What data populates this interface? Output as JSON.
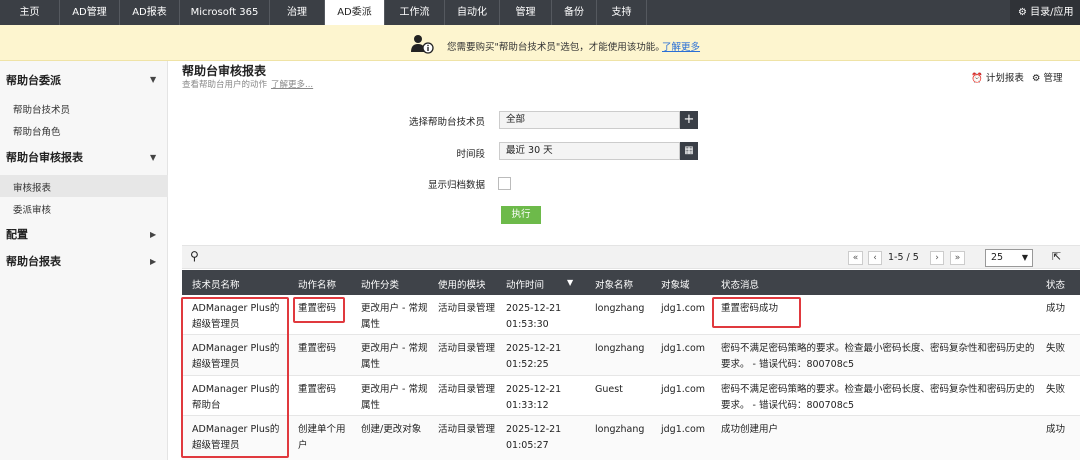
{
  "nav": {
    "tabs": [
      "主页",
      "AD管理",
      "AD报表",
      "Microsoft 365",
      "治理",
      "AD委派",
      "工作流",
      "自动化",
      "管理",
      "备份",
      "支持"
    ],
    "active": "AD委派",
    "tools": "目录/应用"
  },
  "banner": {
    "message": "您需要购买\"帮助台技术员\"选包，才能使用该功能。",
    "link": "了解更多"
  },
  "sidebar": {
    "sections": [
      {
        "title": "帮助台委派",
        "items": [
          "帮助台技术员",
          "帮助台角色"
        ]
      },
      {
        "title": "帮助台审核报表",
        "items": [
          "审核报表",
          "委派审核"
        ]
      },
      {
        "title": "配置",
        "items": []
      },
      {
        "title": "帮助台报表",
        "items": []
      }
    ],
    "selected": "审核报表"
  },
  "page": {
    "title": "帮助台审核报表",
    "subtitle": "查看帮助台用户的动作",
    "learn_more": "了解更多...",
    "schedule": "计划报表",
    "manage": "管理"
  },
  "form": {
    "tech_label": "选择帮助台技术员",
    "tech_value": "全部",
    "period_label": "时间段",
    "period_value": "最近 30 天",
    "archive_label": "显示归档数据",
    "run": "执行"
  },
  "pagination": {
    "range": "1-5 / 5",
    "per_page": "25"
  },
  "table": {
    "headers": [
      "技术员名称",
      "动作名称",
      "动作分类",
      "使用的模块",
      "动作时间",
      "对象名称",
      "对象域",
      "状态消息",
      "状态"
    ],
    "rows": [
      {
        "tech": "ADManager Plus的超级管理员",
        "action": "重置密码",
        "category": "更改用户 - 常规属性",
        "module": "活动目录管理",
        "time": "2025-12-21 01:53:30",
        "object": "longzhang",
        "domain": "jdg1.com",
        "message": "重置密码成功",
        "status": "成功"
      },
      {
        "tech": "ADManager Plus的超级管理员",
        "action": "重置密码",
        "category": "更改用户 - 常规属性",
        "module": "活动目录管理",
        "time": "2025-12-21 01:52:25",
        "object": "longzhang",
        "domain": "jdg1.com",
        "message": "密码不满足密码策略的要求。检查最小密码长度、密码复杂性和密码历史的要求。 - 错误代码：800708c5",
        "status": "失败"
      },
      {
        "tech": "ADManager Plus的帮助台",
        "action": "重置密码",
        "category": "更改用户 - 常规属性",
        "module": "活动目录管理",
        "time": "2025-12-21 01:33:12",
        "object": "Guest",
        "domain": "jdg1.com",
        "message": "密码不满足密码策略的要求。检查最小密码长度、密码复杂性和密码历史的要求。 - 错误代码：800708c5",
        "status": "失败"
      },
      {
        "tech": "ADManager Plus的超级管理员",
        "action": "创建单个用户",
        "category": "创建/更改对象",
        "module": "活动目录管理",
        "time": "2025-12-21 01:05:27",
        "object": "longzhang",
        "domain": "jdg1.com",
        "message": "成功创建用户",
        "status": "成功"
      }
    ]
  },
  "colors": {
    "nav_bg": "#3b3f45",
    "banner_bg": "#fdf5cf",
    "run_button": "#6dba4a",
    "highlight": "#e0393e"
  }
}
